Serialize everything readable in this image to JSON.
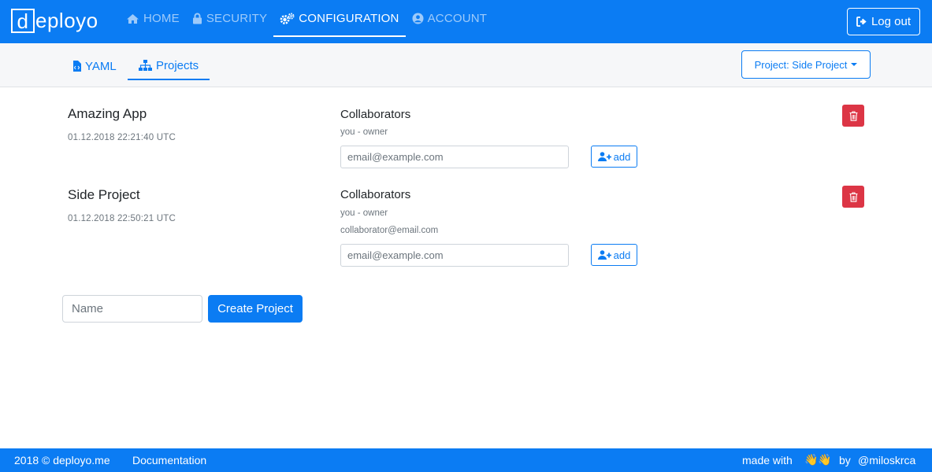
{
  "brand": {
    "logo_letter": "d",
    "logo_rest": "eployo"
  },
  "nav": {
    "home": "HOME",
    "security": "SECURITY",
    "configuration": "CONFIGURATION",
    "account": "ACCOUNT",
    "logout": "Log out"
  },
  "subnav": {
    "yaml": "YAML",
    "projects": "Projects",
    "project_selector": "Project: Side Project"
  },
  "projects": [
    {
      "name": "Amazing App",
      "date": "01.12.2018 22:21:40 UTC",
      "collaborators_title": "Collaborators",
      "collaborators": [
        "you - owner"
      ],
      "email_placeholder": "email@example.com",
      "add_label": "add"
    },
    {
      "name": "Side Project",
      "date": "01.12.2018 22:50:21 UTC",
      "collaborators_title": "Collaborators",
      "collaborators": [
        "you - owner",
        "collaborator@email.com"
      ],
      "email_placeholder": "email@example.com",
      "add_label": "add"
    }
  ],
  "create": {
    "name_placeholder": "Name",
    "button": "Create Project"
  },
  "footer": {
    "copyright": "2018 © deployo.me",
    "documentation": "Documentation",
    "made_with": "made with",
    "emojis": "👋👋",
    "by": "by",
    "author": "@miloskrca"
  },
  "colors": {
    "primary": "#0b7cf3",
    "danger": "#dc3545",
    "subnav_bg": "#f6f7f9"
  }
}
